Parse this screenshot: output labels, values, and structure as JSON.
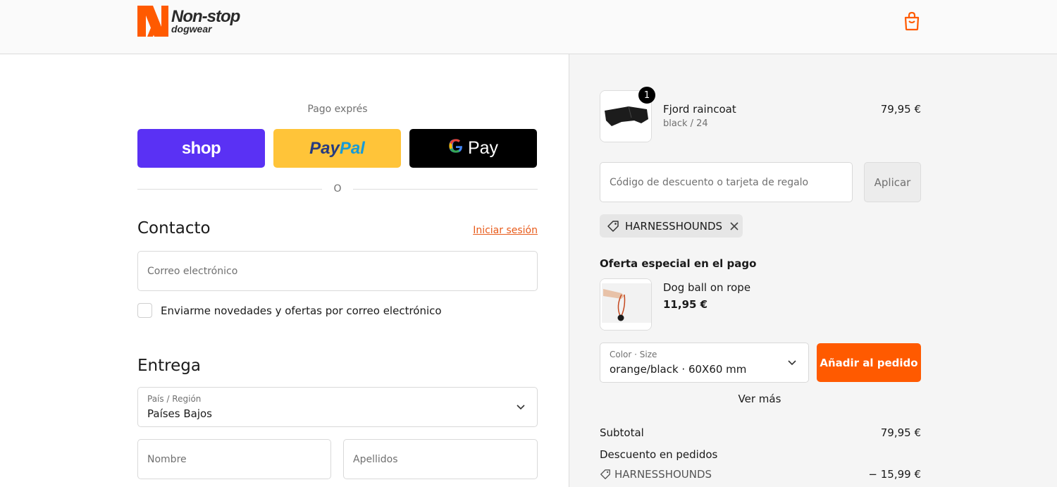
{
  "brand": {
    "name_line1": "Non-stop",
    "name_line2": "dogwear",
    "accent": "#ff5a00"
  },
  "header": {
    "cart_icon": "shopping-bag-icon"
  },
  "express": {
    "label": "Pago exprés",
    "shop_label": "shop",
    "paypal_pay": "Pay",
    "paypal_pal": "Pal",
    "gpay_g": "G",
    "gpay_label": "Pay",
    "divider": "O"
  },
  "contact": {
    "title": "Contacto",
    "login_link": "Iniciar sesión",
    "email_placeholder": "Correo electrónico",
    "newsletter_label": "Enviarme novedades y ofertas por correo electrónico"
  },
  "delivery": {
    "title": "Entrega",
    "country_label": "País / Región",
    "country_value": "Países Bajos",
    "first_name_placeholder": "Nombre",
    "last_name_placeholder": "Apellidos"
  },
  "order": {
    "item": {
      "name": "Fjord raincoat",
      "variant": "black / 24",
      "price": "79,95 €",
      "quantity": "1"
    },
    "discount_placeholder": "Código de descuento o tarjeta de regalo",
    "apply_label": "Aplicar",
    "applied_code": "HARNESSHOUNDS",
    "offer_title": "Oferta especial en el pago",
    "offer_item": {
      "name": "Dog ball on rope",
      "price": "11,95 €"
    },
    "variant_select_label": "Color · Size",
    "variant_select_value": "orange/black · 60X60 mm",
    "add_label": "Añadir al pedido",
    "see_more": "Ver más",
    "subtotal_label": "Subtotal",
    "subtotal_value": "79,95 €",
    "discount_label": "Descuento en pedidos",
    "discount_code": "HARNESSHOUNDS",
    "discount_value": "− 15,99 €"
  }
}
